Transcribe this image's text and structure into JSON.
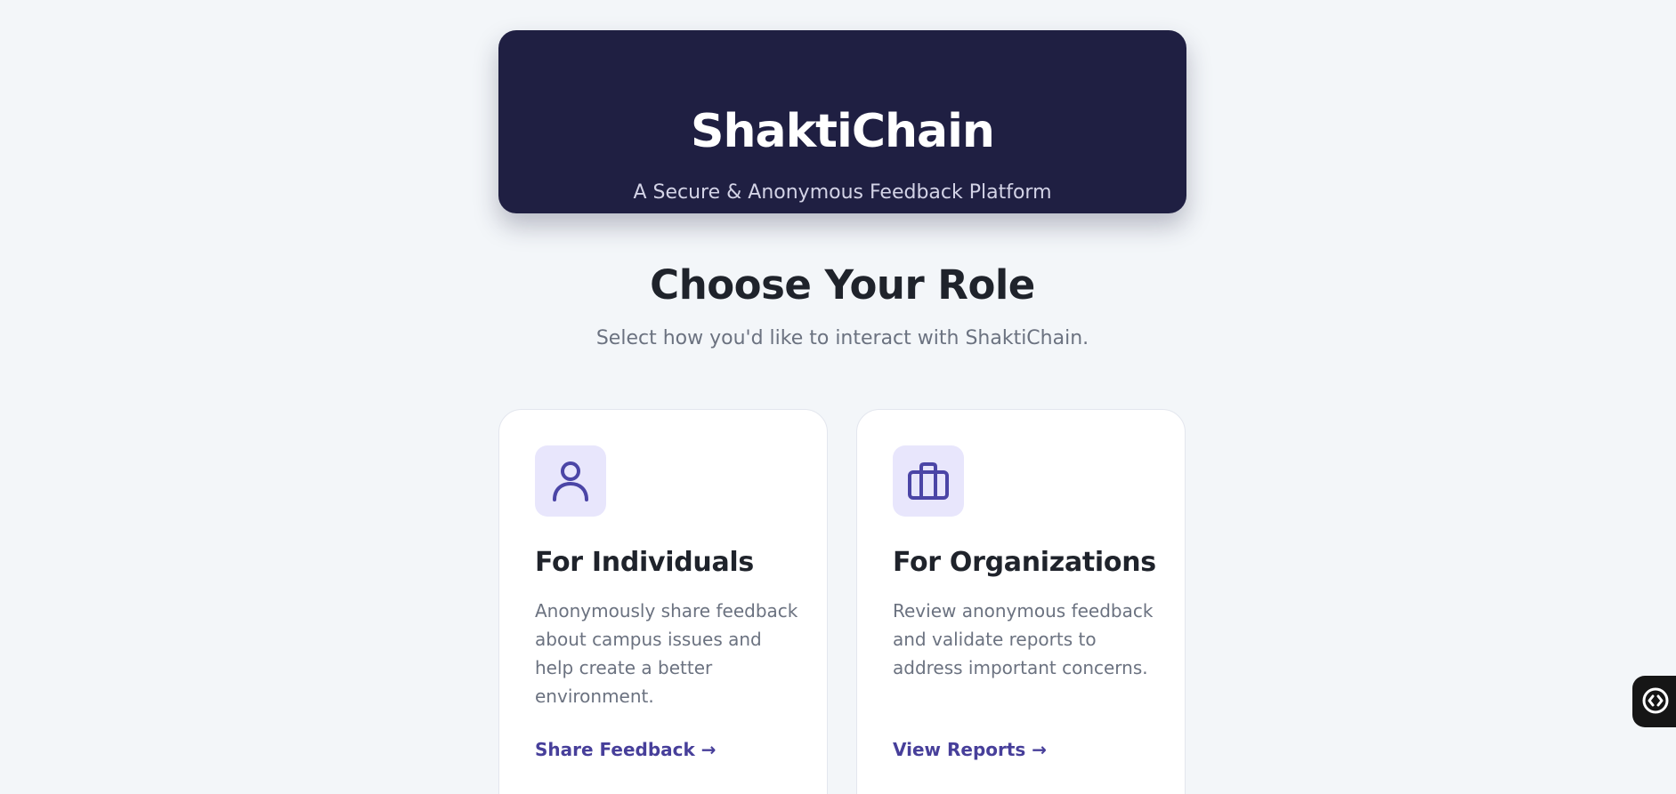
{
  "hero": {
    "title": "ShaktiChain",
    "subtitle": "A Secure & Anonymous Feedback Platform"
  },
  "roles": {
    "title": "Choose Your Role",
    "subtitle": "Select how you'd like to interact with ShaktiChain."
  },
  "cards": [
    {
      "icon": "user-icon",
      "title": "For Individuals",
      "description": "Anonymously share feedback about campus issues and help create a better environment.",
      "link": "Share Feedback →"
    },
    {
      "icon": "briefcase-icon",
      "title": "For Organizations",
      "description": "Review anonymous feedback and validate reports to address important concerns.",
      "link": "View Reports →"
    }
  ],
  "colors": {
    "hero_bg": "#1f1f42",
    "accent": "#473f9a",
    "icon_bg": "#e8e6fc",
    "page_bg": "#f3f6f9"
  },
  "floating_button": {
    "icon": "code-search-icon"
  }
}
